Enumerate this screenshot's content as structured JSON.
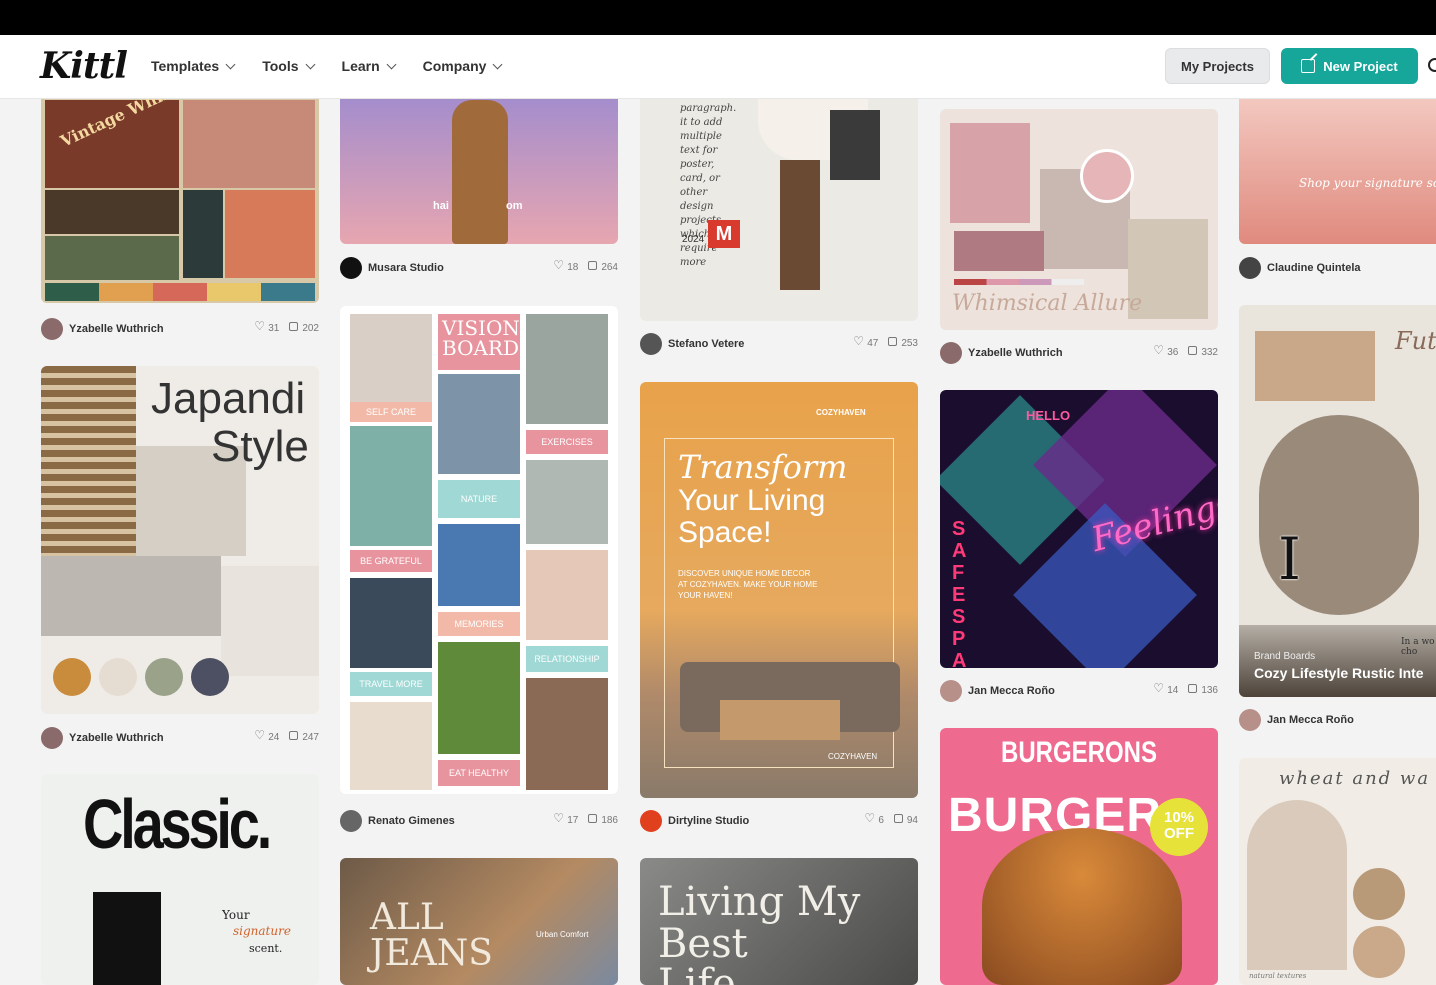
{
  "nav": {
    "logo": "Kittl",
    "menu": [
      {
        "label": "Templates"
      },
      {
        "label": "Tools"
      },
      {
        "label": "Learn"
      },
      {
        "label": "Company"
      }
    ],
    "my_projects": "My Projects",
    "new_project": "New Project"
  },
  "cards": {
    "c1": {
      "title": "Vintage Whims",
      "author": "Yzabelle Wuthrich",
      "likes": "31",
      "copies": "202"
    },
    "c2": {
      "title_left": "hai",
      "title_right": "om",
      "author": "Musara Studio",
      "likes": "18",
      "copies": "264"
    },
    "c3": {
      "script": "paragraph. it to add multiple text for poster, card, or other design projects which require more",
      "year": "2024",
      "badge": "M",
      "author": "Stefano Vetere",
      "likes": "47",
      "copies": "253"
    },
    "c4": {
      "script": "Whimsical Allure",
      "author": "Yzabelle Wuthrich",
      "likes": "36",
      "copies": "332"
    },
    "c5": {
      "script": "Shop your signature scent",
      "author": "Claudine Quintela"
    },
    "c6": {
      "title1": "Japandi",
      "title2": "Style",
      "author": "Yzabelle Wuthrich",
      "likes": "24",
      "copies": "247"
    },
    "c7": {
      "title": "VISION BOARD",
      "labels": [
        "SELF CARE",
        "EXERCISES",
        "NATURE",
        "BE GRATEFUL",
        "MEMORIES",
        "RELATIONSHIP",
        "TRAVEL MORE",
        "EAT HEALTHY"
      ],
      "author": "Renato Gimenes",
      "likes": "17",
      "copies": "186"
    },
    "c8": {
      "brand": "COZYHAVEN",
      "line1": "Transform",
      "line2": "Your Living",
      "line3": "Space!",
      "body": "DISCOVER UNIQUE HOME DECOR AT COZYHAVEN. MAKE YOUR HOME YOUR HAVEN!",
      "footer": "COZYHAVEN",
      "author": "Dirtyline Studio",
      "likes": "6",
      "copies": "94"
    },
    "c9": {
      "hello": "HELLO",
      "script": "Feelings",
      "vertical": "SAFE SPACE",
      "author": "Jan Mecca Roño",
      "likes": "14",
      "copies": "136"
    },
    "c10": {
      "script": "Future",
      "small": "In a wo cho",
      "tag": "Brand Boards",
      "title": "Cozy Lifestyle Rustic Inte",
      "author": "Jan Mecca Roño"
    },
    "c11": {
      "title": "Classic.",
      "tag1": "Your",
      "tag2": "signature",
      "tag3": "scent."
    },
    "c12": {
      "title1": "ALL",
      "title2": "JEANS",
      "brand": "Urban Comfort"
    },
    "c13": {
      "title1": "Living My",
      "title2": "Best",
      "title3": "Life"
    },
    "c14": {
      "title": "BURGERONS",
      "burger": "BURGER",
      "badge1": "10%",
      "badge2": "OFF"
    },
    "c15": {
      "script": "wheat and wa",
      "caption": "natural textures"
    }
  },
  "colors": {
    "accent": "#17a69a",
    "nav_bg": "#ffffff"
  }
}
